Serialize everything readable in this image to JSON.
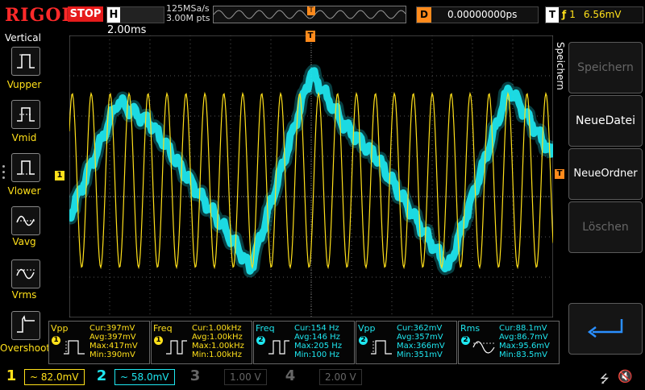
{
  "top": {
    "logo": "RIGOL",
    "run_status": "STOP",
    "timebase_key": "H",
    "timebase": "2.00ms",
    "sample_rate": "125MSa/s",
    "memory_depth": "3.00M pts",
    "trigger_marker": "T",
    "delay_key": "D",
    "delay": "0.00000000ps",
    "trigger_key": "T",
    "trigger_source": "1",
    "trigger_level": "6.56mV"
  },
  "left_menu": {
    "title": "Vertical",
    "items": [
      {
        "label": "Vupper",
        "icon": "vupper-icon"
      },
      {
        "label": "Vmid",
        "icon": "vmid-icon"
      },
      {
        "label": "Vlower",
        "icon": "vlower-icon"
      },
      {
        "label": "Vavg",
        "icon": "vavg-icon"
      },
      {
        "label": "Vrms",
        "icon": "vrms-icon"
      },
      {
        "label": "Overshoot",
        "icon": "overshoot-icon"
      }
    ]
  },
  "screen": {
    "ch1_marker": "1",
    "trigger_top_marker": "T",
    "trigger_level_marker": "T"
  },
  "right_menu": {
    "title": "Speichern",
    "buttons": [
      {
        "label": "Speichern",
        "enabled": false
      },
      {
        "label": "NeueDatei",
        "enabled": true
      },
      {
        "label": "NeueOrdner",
        "enabled": true
      },
      {
        "label": "Löschen",
        "enabled": false
      },
      {
        "label": "",
        "enabled": true,
        "icon": "return-arrow-icon"
      }
    ]
  },
  "measurements": [
    {
      "name": "Vpp",
      "channel": "1",
      "cur": "Cur:397mV",
      "avg": "Avg:397mV",
      "max": "Max:417mV",
      "min": "Min:390mV"
    },
    {
      "name": "Freq",
      "channel": "1",
      "cur": "Cur:1.00kHz",
      "avg": "Avg:1.00kHz",
      "max": "Max:1.00kHz",
      "min": "Min:1.00kHz"
    },
    {
      "name": "Freq",
      "channel": "2",
      "cur": "Cur:154 Hz",
      "avg": "Avg:146 Hz",
      "max": "Max:205 Hz",
      "min": "Min:100 Hz"
    },
    {
      "name": "Vpp",
      "channel": "2",
      "cur": "Cur:362mV",
      "avg": "Avg:357mV",
      "max": "Max:366mV",
      "min": "Min:351mV"
    },
    {
      "name": "Rms",
      "channel": "2",
      "cur": "Cur:88.1mV",
      "avg": "Avg:86.7mV",
      "max": "Max:95.6mV",
      "min": "Min:83.5mV"
    }
  ],
  "channels": [
    {
      "num": "1",
      "scale": "~ 82.0mV",
      "active": true
    },
    {
      "num": "2",
      "scale": "~ 58.0mV",
      "active": true
    },
    {
      "num": "3",
      "scale": "1.00 V",
      "active": false
    },
    {
      "num": "4",
      "scale": "2.00 V",
      "active": false
    }
  ],
  "colors": {
    "ch1": "#ffe01a",
    "ch2": "#1ee7f0",
    "trigger": "#ff8a1c",
    "stop": "#e61b1b",
    "ch3": "#c03cff",
    "ch4": "#3c64ff"
  }
}
